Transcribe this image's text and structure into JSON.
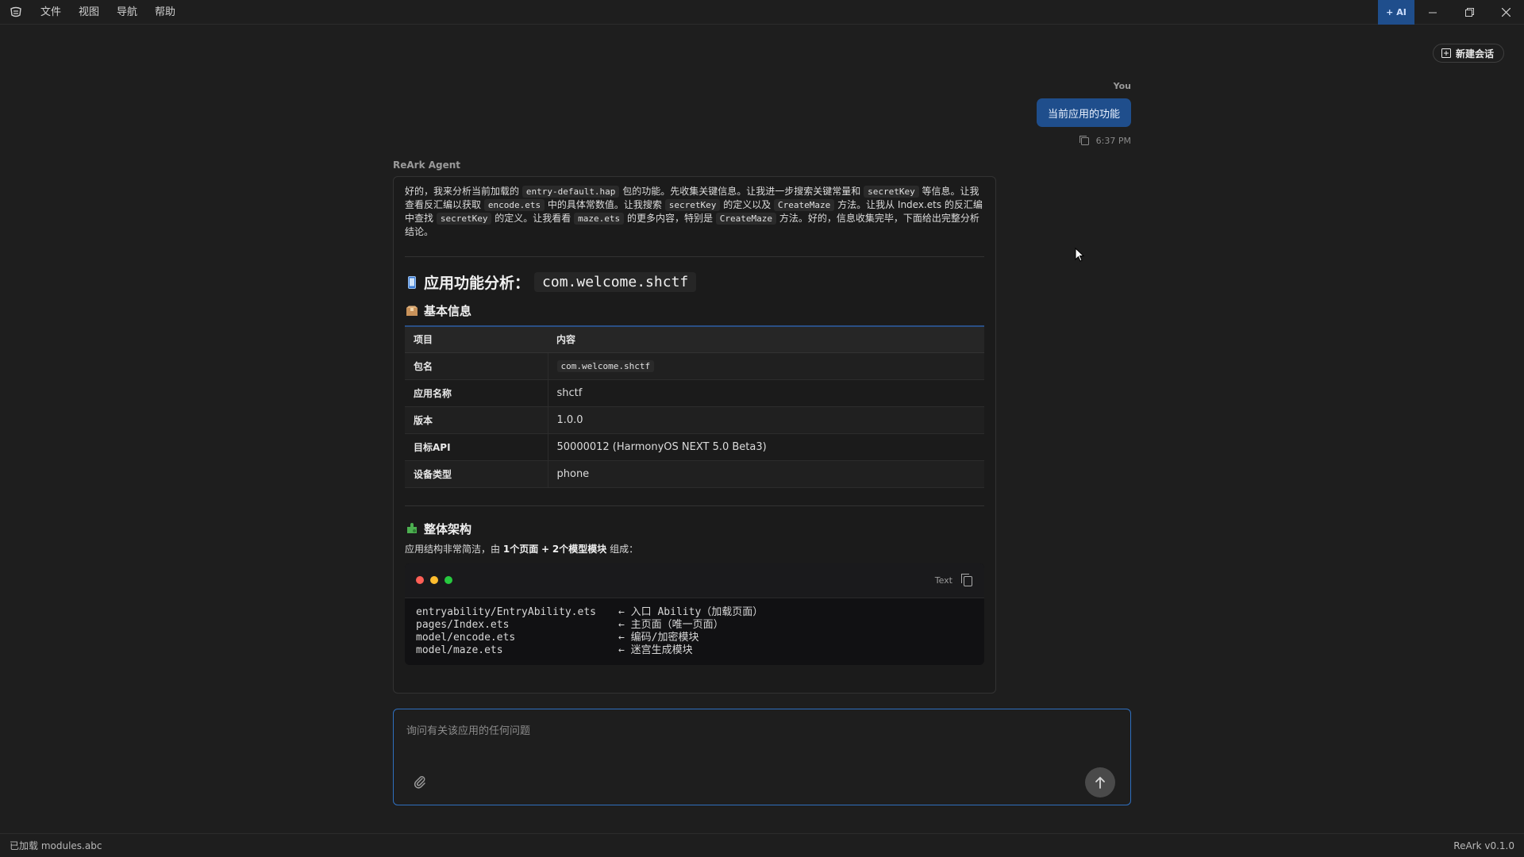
{
  "menu": {
    "file": "文件",
    "view": "视图",
    "nav": "导航",
    "help": "帮助"
  },
  "titlebar": {
    "ai_label": "+ AI"
  },
  "toolbar": {
    "new_chat": "新建会话"
  },
  "user_message": {
    "label": "You",
    "text": "当前应用的功能",
    "time": "6:37 PM"
  },
  "agent": {
    "label": "ReArk Agent",
    "intro": {
      "p1": "好的，我来分析当前加载的",
      "c1": "entry-default.hap",
      "p2": "包的功能。先收集关键信息。让我进一步搜索关键常量和",
      "c2": "secretKey",
      "p3": "等信息。让我查看反汇编以获取",
      "c3": "encode.ets",
      "p4": "中的具体常数值。让我搜索",
      "c4": "secretKey",
      "p5": "的定义以及",
      "c5": "CreateMaze",
      "p6": "方法。让我从 Index.ets 的反汇编中查找",
      "c6": "secretKey",
      "p7": "的定义。让我看看",
      "c7": "maze.ets",
      "p8": "的更多内容，特别是",
      "c8": "CreateMaze",
      "p9": "方法。好的，信息收集完毕，下面给出完整分析结论。"
    },
    "h2_icon": "mobile-phone-icon",
    "h2_title": "应用功能分析：",
    "h2_pkg": "com.welcome.shctf",
    "basic_title": "基本信息",
    "table": {
      "headers": [
        "项目",
        "内容"
      ],
      "rows": [
        {
          "k": "包名",
          "v": "com.welcome.shctf"
        },
        {
          "k": "应用名称",
          "v": "shctf"
        },
        {
          "k": "版本",
          "v": "1.0.0"
        },
        {
          "k": "目标API",
          "v": "50000012 (HarmonyOS NEXT 5.0 Beta3)"
        },
        {
          "k": "设备类型",
          "v": "phone"
        }
      ]
    },
    "arch_title": "整体架构",
    "arch_text": {
      "p1": "应用结构非常简洁，由",
      "b1": "1个页面",
      "p2": "+",
      "b2": "2个模型模块",
      "p3": "组成："
    },
    "code": {
      "lang": "Text",
      "lines": [
        {
          "path": "entryability/EntryAbility.ets",
          "note": "← 入口 Ability（加载页面）"
        },
        {
          "path": "pages/Index.ets",
          "note": "← 主页面（唯一页面）"
        },
        {
          "path": "model/encode.ets",
          "note": "← 编码/加密模块"
        },
        {
          "path": "model/maze.ets",
          "note": "← 迷宫生成模块"
        }
      ]
    }
  },
  "input": {
    "placeholder": "询问有关该应用的任何问题"
  },
  "status": {
    "left": "已加载 modules.abc",
    "right": "ReArk v0.1.0"
  },
  "colors": {
    "accent": "#1f4e8c",
    "border_focus": "#2f6fbf"
  }
}
